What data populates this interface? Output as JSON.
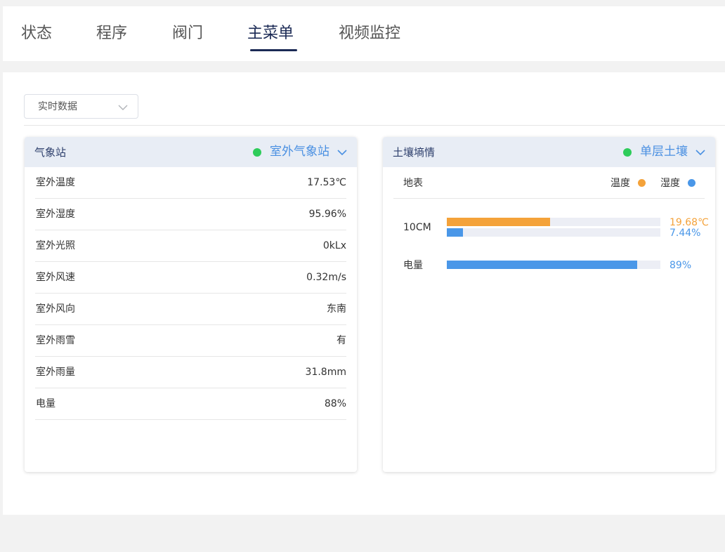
{
  "tabs": [
    {
      "label": "状态"
    },
    {
      "label": "程序"
    },
    {
      "label": "阀门"
    },
    {
      "label": "主菜单"
    },
    {
      "label": "视频监控"
    }
  ],
  "active_tab": "主菜单",
  "data_select": {
    "value": "实时数据"
  },
  "weather_card": {
    "title": "气象站",
    "status_color": "#2ecc5a",
    "station_select": "室外气象站",
    "rows": [
      {
        "label": "室外温度",
        "value": "17.53℃"
      },
      {
        "label": "室外湿度",
        "value": "95.96%"
      },
      {
        "label": "室外光照",
        "value": "0kLx"
      },
      {
        "label": "室外风速",
        "value": "0.32m/s"
      },
      {
        "label": "室外风向",
        "value": "东南"
      },
      {
        "label": "室外雨雪",
        "value": "有"
      },
      {
        "label": "室外雨量",
        "value": "31.8mm"
      },
      {
        "label": "电量",
        "value": "88%"
      }
    ]
  },
  "soil_card": {
    "title": "土壤墒情",
    "status_color": "#2ecc5a",
    "layer_select": "单层土壤",
    "surface_label": "地表",
    "legend": [
      {
        "label": "温度",
        "color": "#f4a23a"
      },
      {
        "label": "湿度",
        "color": "#4a97e8"
      }
    ],
    "depth": {
      "label": "10CM",
      "temperature": {
        "text": "19.68℃",
        "fraction": 0.4836,
        "color": "#f4a23a"
      },
      "humidity": {
        "text": "7.44%",
        "fraction": 0.0744,
        "color": "#4a97e8"
      }
    },
    "battery": {
      "label": "电量",
      "text": "89%",
      "fraction": 0.89,
      "color": "#4a97e8"
    }
  }
}
